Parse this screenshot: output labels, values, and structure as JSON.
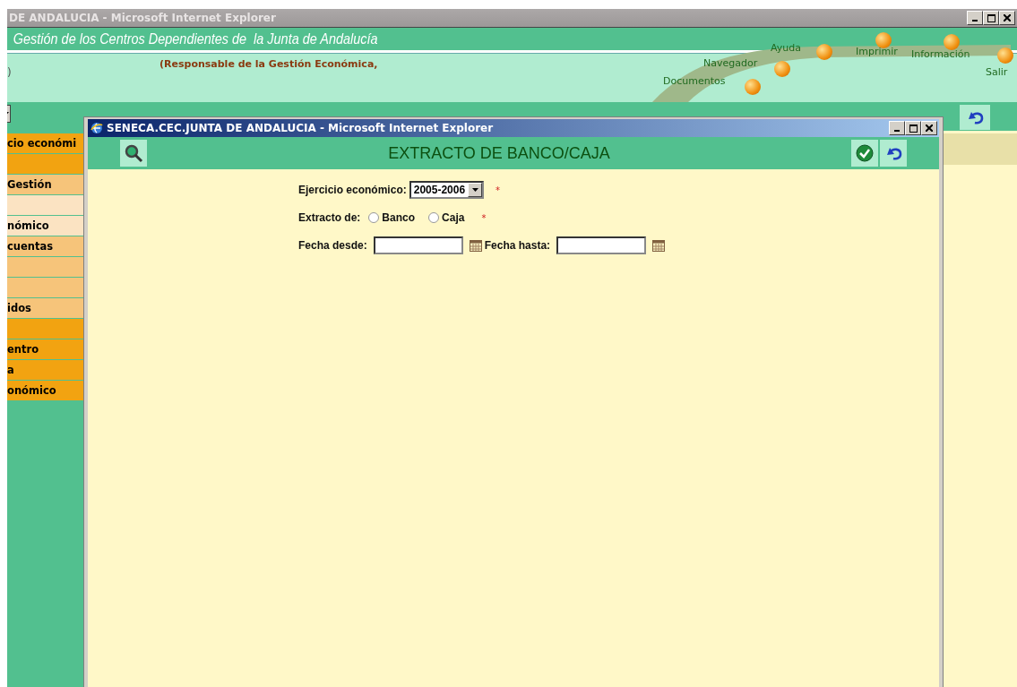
{
  "outer_window": {
    "title": "DE ANDALUCIA - Microsoft Internet Explorer"
  },
  "app_banner": {
    "title": "Gestión de los Centros Dependientes de  la Junta de Andalucía"
  },
  "header": {
    "left_fragment": ")",
    "role_text": "(Responsable de la Gestión Económica,",
    "nav_links": [
      {
        "label": "Documentos"
      },
      {
        "label": "Navegador"
      },
      {
        "label": "Ayuda"
      },
      {
        "label": "Imprimir"
      },
      {
        "label": "Información"
      },
      {
        "label": "Salir"
      }
    ]
  },
  "sidebar": {
    "items": [
      {
        "label": "cio económi",
        "color": "#f2a311"
      },
      {
        "color": "#f2a311"
      },
      {
        "label": "Gestión",
        "color": "#f6c47a"
      },
      {
        "color": "#fbe3c2"
      },
      {
        "label": "nómico",
        "color": "#fbe3c2"
      },
      {
        "label": "cuentas",
        "color": "#f6c47a"
      },
      {
        "color": "#f6c47a"
      },
      {
        "color": "#f6c47a"
      },
      {
        "label": "idos",
        "color": "#f6c47a"
      },
      {
        "color": "#f2a311"
      },
      {
        "label": "entro",
        "color": "#f2a311"
      },
      {
        "label": "a",
        "color": "#f2a311"
      },
      {
        "label": "onómico",
        "color": "#f2a311"
      }
    ]
  },
  "popup": {
    "title": "SENECA.CEC.JUNTA DE ANDALUCIA - Microsoft Internet Explorer",
    "heading": "EXTRACTO DE BANCO/CAJA",
    "form": {
      "ejercicio": {
        "label": "Ejercicio económico:",
        "value": "2005-2006",
        "required_mark": "*"
      },
      "extracto": {
        "label": "Extracto de:",
        "options": [
          {
            "label": "Banco",
            "selected": false
          },
          {
            "label": "Caja",
            "selected": false
          }
        ],
        "required_mark": "*"
      },
      "dates": [
        {
          "label": "Fecha desde:"
        },
        {
          "label": "Fecha hasta:"
        }
      ]
    }
  }
}
